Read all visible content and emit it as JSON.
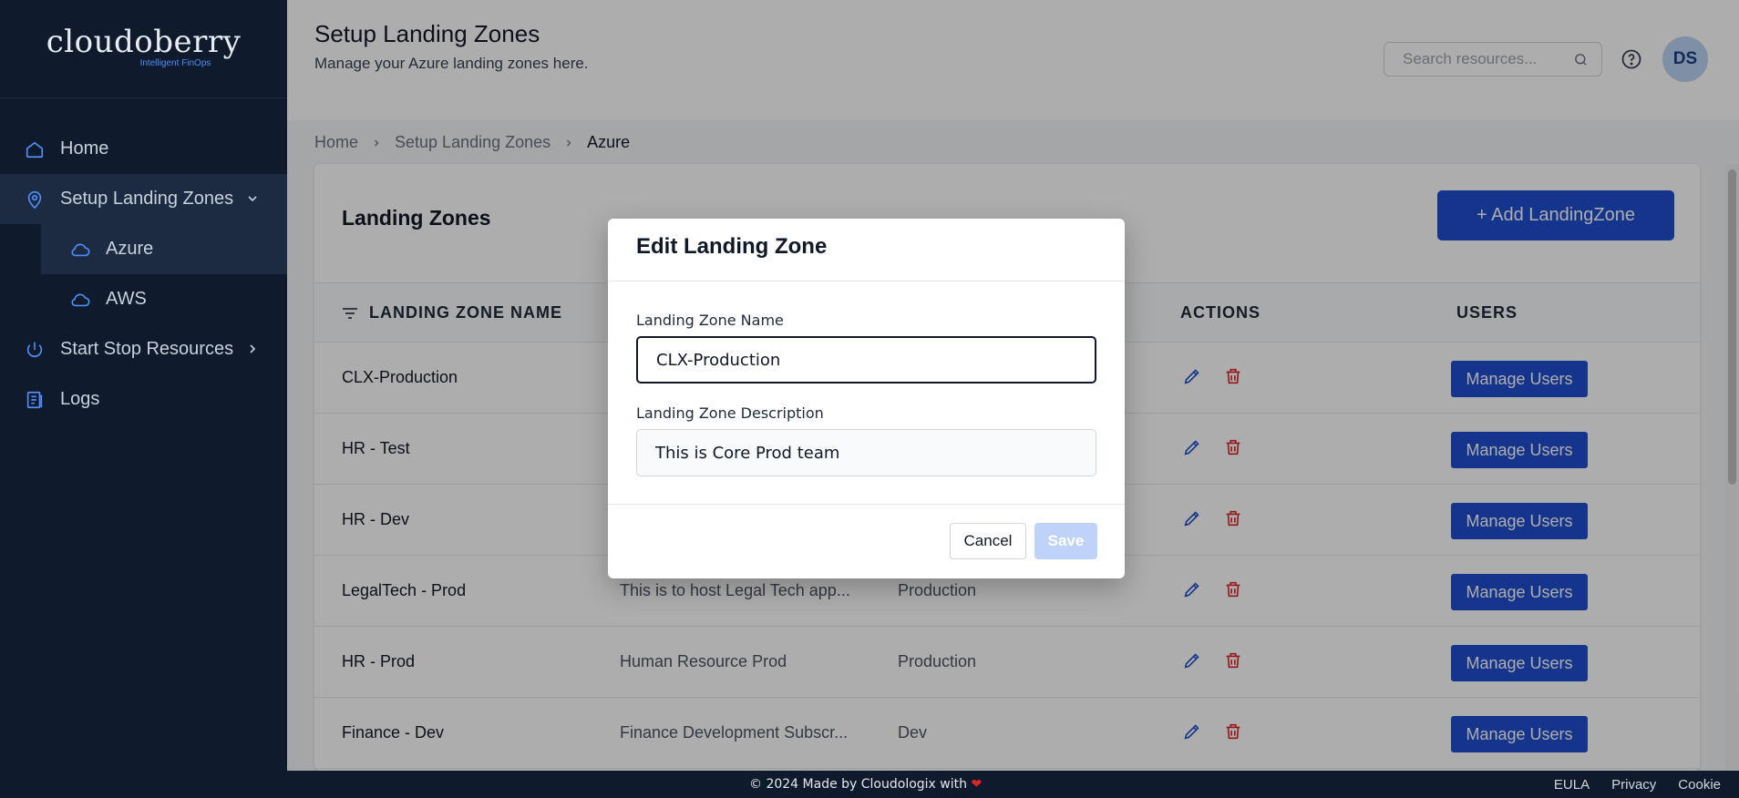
{
  "brand": {
    "name": "cloudoberry",
    "tagline": "Intelligent FinOps"
  },
  "sidebar": {
    "items": [
      {
        "label": "Home",
        "icon": "home-icon"
      },
      {
        "label": "Setup Landing Zones",
        "icon": "location-pin-icon",
        "expanded": true
      },
      {
        "label": "Azure",
        "icon": "cloud-icon"
      },
      {
        "label": "AWS",
        "icon": "cloud-icon"
      },
      {
        "label": "Start Stop Resources",
        "icon": "power-icon"
      },
      {
        "label": "Logs",
        "icon": "document-list-icon"
      }
    ]
  },
  "header": {
    "title": "Setup Landing Zones",
    "subtitle": "Manage your Azure landing zones here.",
    "search_placeholder": "Search resources...",
    "avatar_initials": "DS"
  },
  "breadcrumb": [
    "Home",
    "Setup Landing Zones",
    "Azure"
  ],
  "card": {
    "title": "Landing Zones",
    "add_button": "+ Add LandingZone"
  },
  "table": {
    "columns": [
      "LANDING ZONE NAME",
      "ACTIONS",
      "USERS"
    ],
    "manage_label": "Manage Users",
    "rows": [
      {
        "name": "CLX-Production",
        "description": "",
        "environment": ""
      },
      {
        "name": "HR - Test",
        "description": "",
        "environment": ""
      },
      {
        "name": "HR - Dev",
        "description": "",
        "environment": ""
      },
      {
        "name": "LegalTech - Prod",
        "description": "This is to host Legal Tech app...",
        "environment": "Production"
      },
      {
        "name": "HR - Prod",
        "description": "Human Resource Prod",
        "environment": "Production"
      },
      {
        "name": "Finance - Dev",
        "description": "Finance Development Subscr...",
        "environment": "Dev"
      }
    ]
  },
  "modal": {
    "title": "Edit Landing Zone",
    "name_label": "Landing Zone Name",
    "name_value": "CLX-Production",
    "desc_label": "Landing Zone Description",
    "desc_value": "This is Core Prod team",
    "cancel_label": "Cancel",
    "save_label": "Save"
  },
  "footer": {
    "copyright": "© 2024 Made by Cloudologix with",
    "heart": "❤",
    "links": [
      "EULA",
      "Privacy",
      "Cookie"
    ]
  },
  "colors": {
    "sidebar_bg": "#0f1b2d",
    "primary": "#1f4fcf",
    "delete": "#dc2626",
    "edit": "#1f4fcf"
  }
}
